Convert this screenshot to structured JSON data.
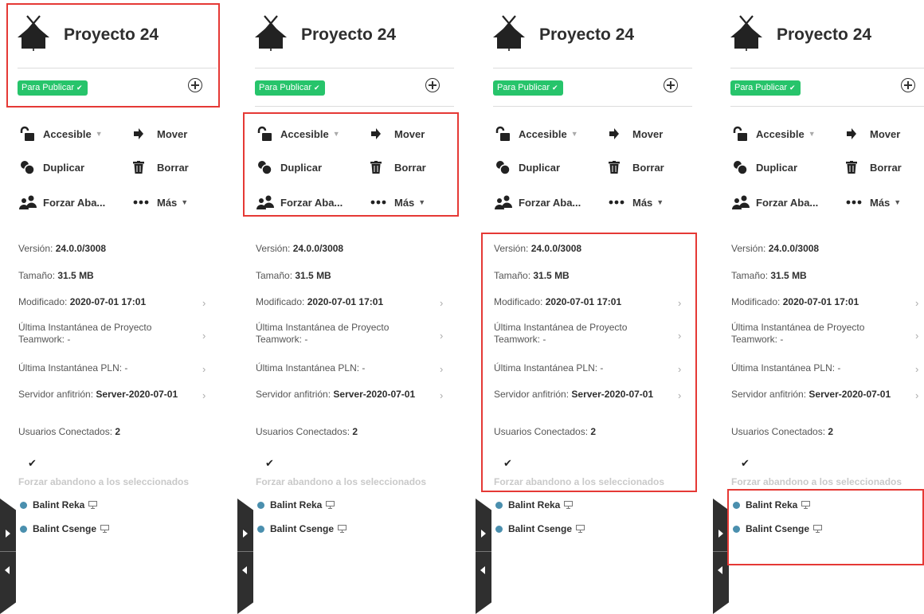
{
  "panel": {
    "title": "Proyecto 24",
    "status_label": "Para Publicar",
    "actions": {
      "access": "Accesible",
      "move": "Mover",
      "duplicate": "Duplicar",
      "delete": "Borrar",
      "force_leave": "Forzar Aba...",
      "more": "Más"
    },
    "info": {
      "version_label": "Versión:",
      "version_value": "24.0.0/3008",
      "size_label": "Tamaño:",
      "size_value": "31.5 MB",
      "modified_label": "Modificado:",
      "modified_value": "2020-07-01 17:01",
      "snapshot_label_1": "Última Instantánea de Proyecto",
      "snapshot_label_2": "Teamwork: -",
      "pln_label": "Última Instantánea PLN: -",
      "host_label": "Servidor anfitrión:",
      "host_value": "Server-2020-07-01",
      "connected_label": "Usuarios Conectados:",
      "connected_value": "2"
    },
    "force_leave_selected": "Forzar abandono a los seleccionados",
    "users": [
      "Balint Reka",
      "Balint Csenge"
    ]
  },
  "colors": {
    "status_green": "#27c46b",
    "user_dot": "#4a8fae",
    "highlight_red": "#e53935"
  },
  "icons": [
    "house-icon",
    "add-circle-icon",
    "unlock-icon",
    "arrow-right-icon",
    "duplicate-icon",
    "trash-icon",
    "users-icon",
    "more-dots-icon",
    "chevron-right-icon",
    "check-icon",
    "monitor-icon",
    "expand-icon",
    "collapse-icon"
  ]
}
